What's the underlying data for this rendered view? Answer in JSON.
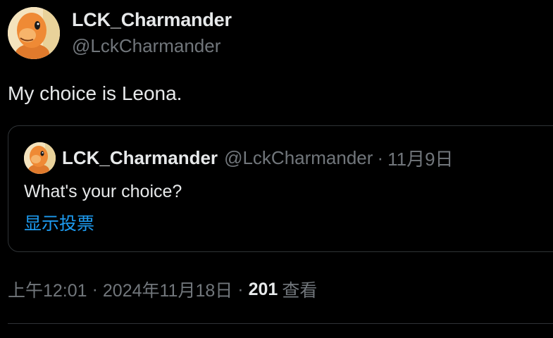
{
  "author": {
    "display_name": "LCK_Charmander",
    "handle": "@LckCharmander",
    "avatar": "charmander-avatar"
  },
  "tweet": {
    "text": "My choice is Leona."
  },
  "quoted_tweet": {
    "display_name": "LCK_Charmander",
    "handle": "@LckCharmander",
    "separator": "·",
    "date": "11月9日",
    "text": "What's your choice?",
    "poll_link": "显示投票",
    "avatar": "charmander-avatar"
  },
  "meta": {
    "time": "上午12:01",
    "separator": "·",
    "date": "2024年11月18日",
    "views_count": "201",
    "views_label": "查看"
  },
  "colors": {
    "background": "#000000",
    "primary_text": "#e7e9ea",
    "secondary_text": "#71767b",
    "link": "#1d9bf0",
    "border": "#2f3336"
  }
}
